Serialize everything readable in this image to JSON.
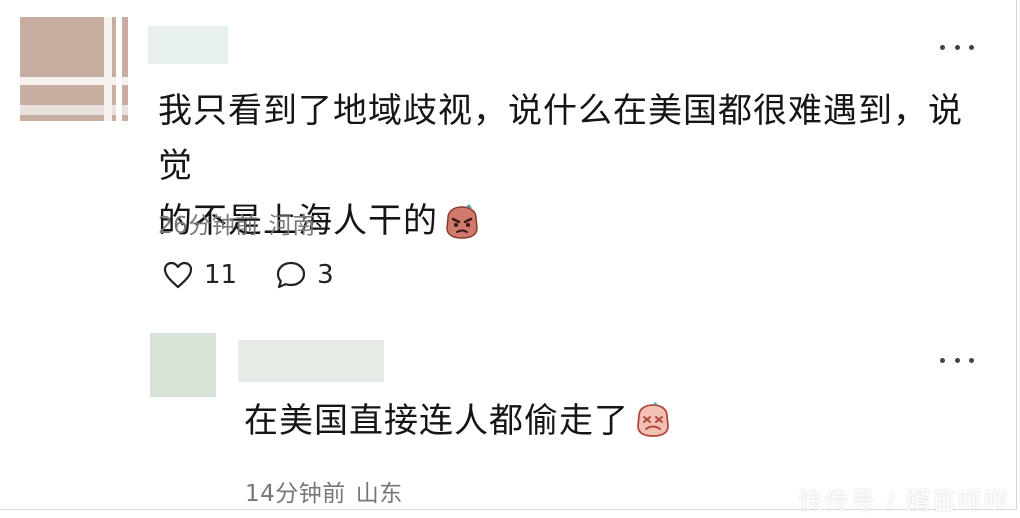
{
  "comment": {
    "text_line1": "我只看到了地域歧视，说什么在美国都很难遇到，说觉",
    "text_line2": "的不是上海人干的",
    "emoji_icon": "angry-face-emoji-icon",
    "time": "26分钟前",
    "location": "河南",
    "like_count": "11",
    "reply_count": "3"
  },
  "reply": {
    "text": "在美国直接连人都偷走了",
    "emoji_icon": "dizzy-face-emoji-icon",
    "time": "14分钟前",
    "location": "山东"
  },
  "watermark": "快传号 / 婿笛咩咩",
  "colors": {
    "meta_text": "#777777",
    "avatar_main": "#c7aea1",
    "avatar_reply": "#d6e3d6",
    "emoji_fill": "#cf7a6c"
  }
}
